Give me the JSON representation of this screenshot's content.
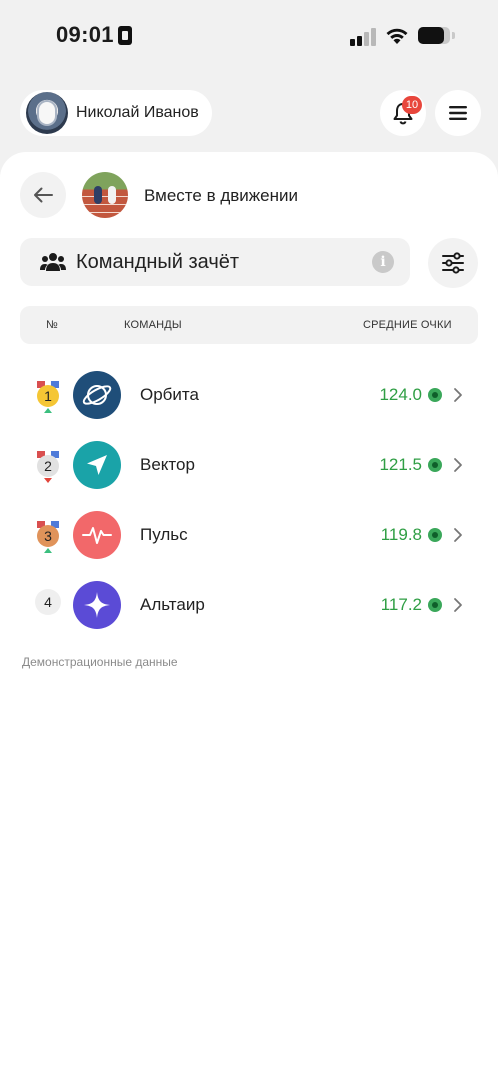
{
  "status_bar": {
    "time": "09:01",
    "battery_level": 0.8
  },
  "header": {
    "user_name": "Николай Иванов",
    "notifications_count": "10"
  },
  "group": {
    "title": "Вместе в движении"
  },
  "scoring": {
    "title": "Командный зачёт"
  },
  "table": {
    "col_rank": "№",
    "col_teams": "КОМАНДЫ",
    "col_score": "СРЕДНИЕ ОЧКИ"
  },
  "teams": [
    {
      "rank": "1",
      "name": "Орбита",
      "score": "124.0",
      "trend": "up",
      "medal": "gold",
      "logo_color": "#1f4e79",
      "icon": "planet-icon"
    },
    {
      "rank": "2",
      "name": "Вектор",
      "score": "121.5",
      "trend": "down",
      "medal": "silver",
      "logo_color": "#1aa3a8",
      "icon": "navigation-arrow-icon"
    },
    {
      "rank": "3",
      "name": "Пульс",
      "score": "119.8",
      "trend": "up",
      "medal": "bronze",
      "logo_color": "#f2686a",
      "icon": "heartbeat-icon"
    },
    {
      "rank": "4",
      "name": "Альтаир",
      "score": "117.2",
      "trend": "none",
      "medal": "none",
      "logo_color": "#5b4bd6",
      "icon": "star-icon"
    }
  ],
  "footnote": "Демонстрационные данные",
  "colors": {
    "score_green": "#2f9e44",
    "badge_red": "#e8463c",
    "trend_up": "#3cbf7f",
    "trend_down": "#e2453c"
  }
}
